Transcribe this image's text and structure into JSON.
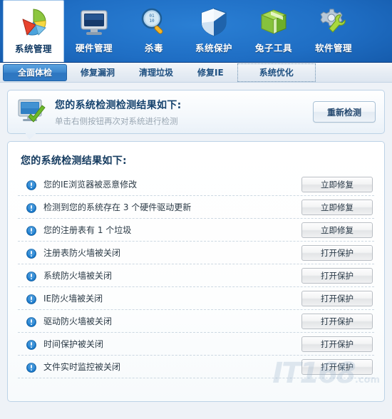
{
  "toolbar": {
    "items": [
      {
        "label": "系统管理",
        "icon": "pie-chart-icon",
        "active": true
      },
      {
        "label": "硬件管理",
        "icon": "monitor-icon",
        "active": false
      },
      {
        "label": "杀毒",
        "icon": "magnifier-icon",
        "active": false
      },
      {
        "label": "系统保护",
        "icon": "shield-icon",
        "active": false
      },
      {
        "label": "兔子工具",
        "icon": "green-box-icon",
        "active": false
      },
      {
        "label": "软件管理",
        "icon": "gear-wrench-icon",
        "active": false
      }
    ]
  },
  "tabs": [
    {
      "label": "全面体检",
      "state": "active"
    },
    {
      "label": "修复漏洞",
      "state": "normal"
    },
    {
      "label": "清理垃圾",
      "state": "normal"
    },
    {
      "label": "修复IE",
      "state": "normal"
    },
    {
      "label": "系统优化",
      "state": "focused"
    }
  ],
  "banner": {
    "icon": "monitor-check-icon",
    "title": "您的系统检测检测结果如下:",
    "subtitle": "单击右侧按钮再次对系统进行检测",
    "rescan_label": "重新检测"
  },
  "results": {
    "title": "您的系统检测结果如下:",
    "rows": [
      {
        "icon": "warning-info-icon",
        "text": "您的IE浏览器被恶意修改",
        "action": "立即修复"
      },
      {
        "icon": "warning-info-icon",
        "text": "检测到您的系统存在 3 个硬件驱动更新",
        "action": "立即修复"
      },
      {
        "icon": "warning-info-icon",
        "text": "您的注册表有 1 个垃圾",
        "action": "立即修复"
      },
      {
        "icon": "warning-info-icon",
        "text": "注册表防火墙被关闭",
        "action": "打开保护"
      },
      {
        "icon": "warning-info-icon",
        "text": "系统防火墙被关闭",
        "action": "打开保护"
      },
      {
        "icon": "warning-info-icon",
        "text": "IE防火墙被关闭",
        "action": "打开保护"
      },
      {
        "icon": "warning-info-icon",
        "text": "驱动防火墙被关闭",
        "action": "打开保护"
      },
      {
        "icon": "warning-info-icon",
        "text": "时间保护被关闭",
        "action": "打开保护"
      },
      {
        "icon": "warning-info-icon",
        "text": "文件实时监控被关闭",
        "action": "打开保护"
      }
    ]
  },
  "watermark": {
    "text": "IT168",
    "suffix": ".com"
  },
  "colors": {
    "toolbar_blue_light": "#2a7fd4",
    "toolbar_blue_dark": "#0b3d82",
    "active_tab_blue": "#3a85cd",
    "panel_border": "#bcd2e6",
    "title_text": "#163c60",
    "info_icon_blue": "#1f7fd0"
  }
}
